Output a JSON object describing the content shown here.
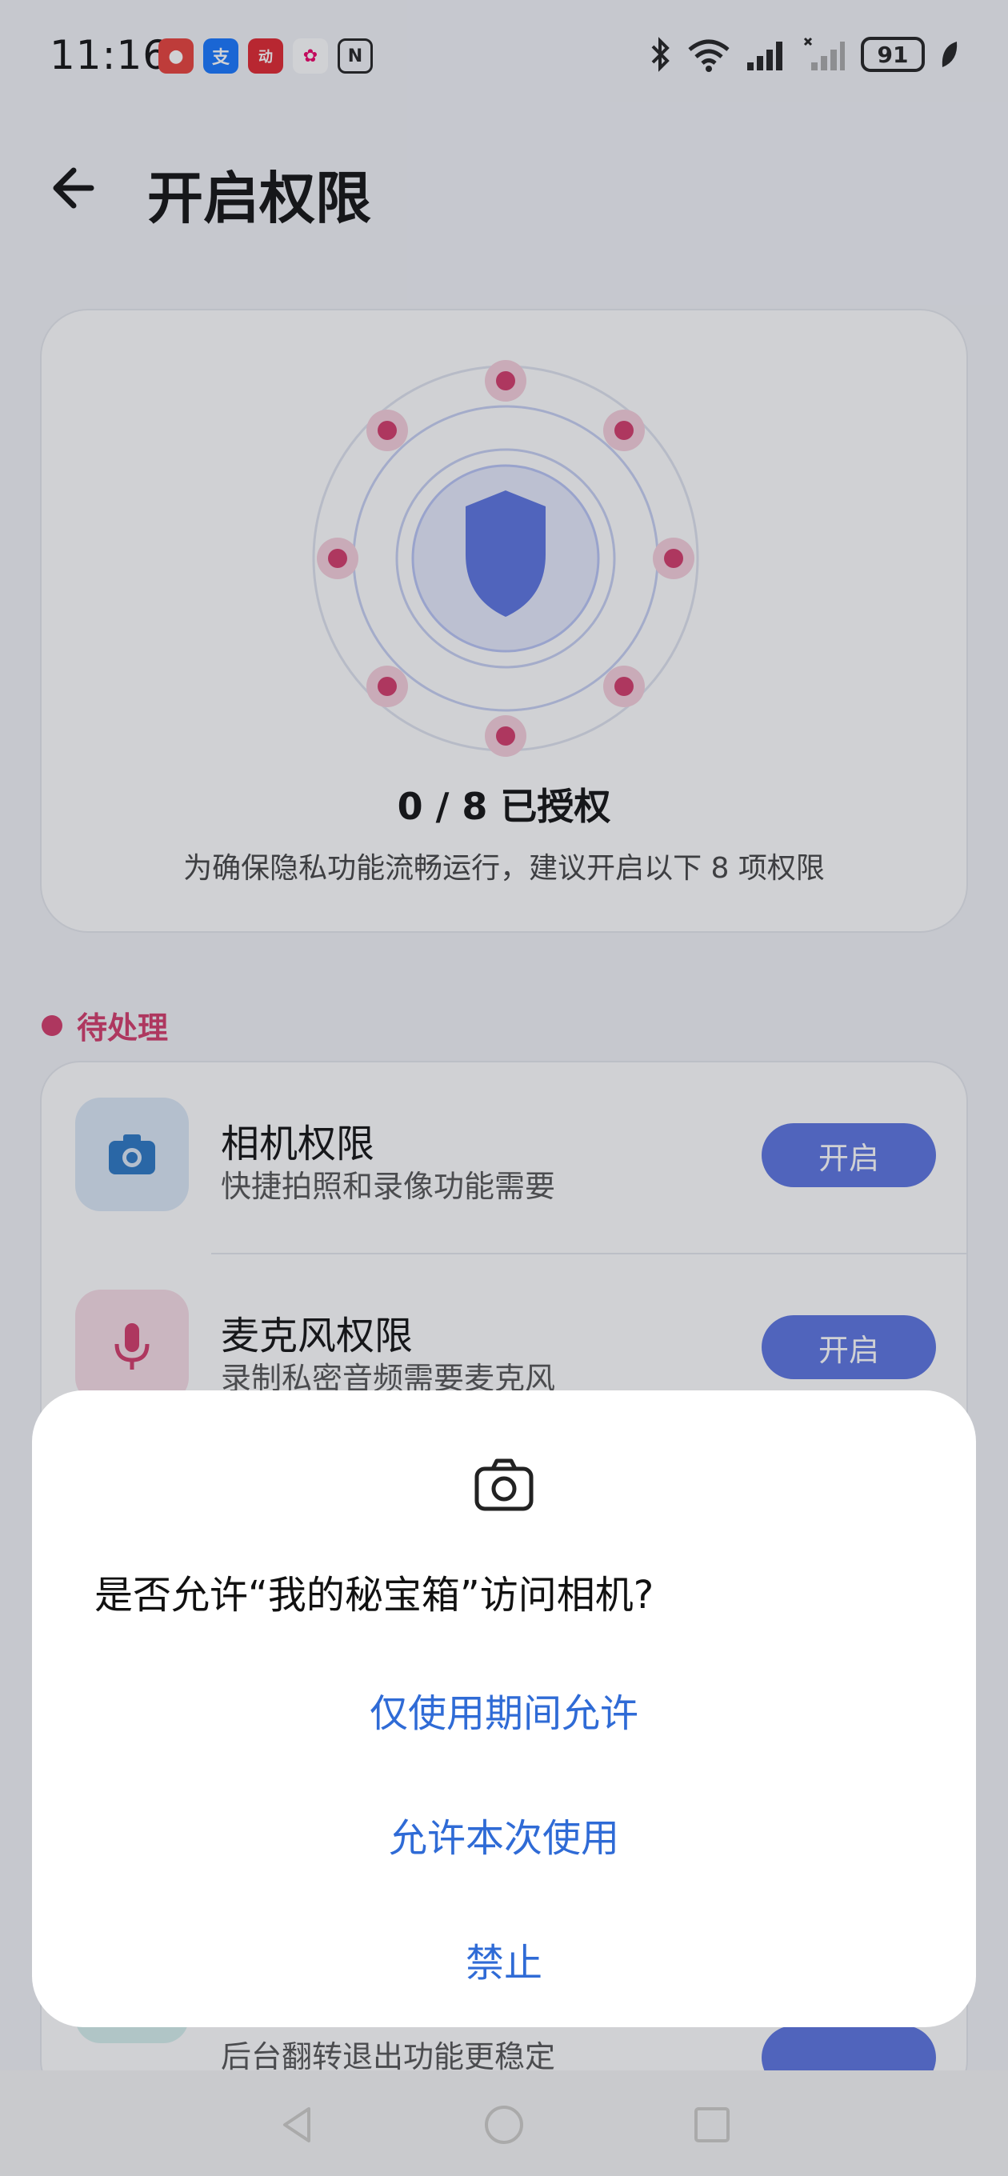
{
  "status_bar": {
    "time": "11:16",
    "battery": "91",
    "apps": [
      {
        "name": "app-red-mascot",
        "color": "#e8403a",
        "glyph": "●"
      },
      {
        "name": "alipay",
        "color": "#1677ff",
        "glyph": "支"
      },
      {
        "name": "app-red-promo",
        "color": "#e0262f",
        "glyph": "动"
      },
      {
        "name": "app-colorful",
        "color": "#ffffff",
        "glyph": "✿"
      },
      {
        "name": "nfc",
        "color": "#c8c9cc",
        "glyph": "N"
      }
    ]
  },
  "header": {
    "title": "开启权限"
  },
  "card": {
    "authorized_count": "0 / 8  已授权",
    "description": "为确保隐私功能流畅运行，建议开启以下 8 项权限"
  },
  "section": {
    "label": "待处理"
  },
  "permissions": [
    {
      "name": "相机权限",
      "desc": "快捷拍照和录像功能需要",
      "button": "开启",
      "icon": "camera-icon",
      "icon_bg": "#dce8f6",
      "icon_color": "#2b78c4"
    },
    {
      "name": "麦克风权限",
      "desc": "录制私密音频需要麦克风",
      "button": "开启",
      "icon": "microphone-icon",
      "icon_bg": "#f8dde6",
      "icon_color": "#d43a6a"
    },
    {
      "name": "",
      "desc": "后台翻转退出功能更稳定",
      "button": "",
      "icon": "sensor-icon",
      "icon_bg": "#d7f0ee",
      "icon_color": "#19a89a"
    }
  ],
  "dialog": {
    "title": "是否允许“我的秘宝箱”访问相机?",
    "actions": [
      "仅使用期间允许",
      "允许本次使用",
      "禁止"
    ]
  },
  "colors": {
    "accent": "#5b74e0",
    "pending": "#d43a6a",
    "dialog_action": "#2f6bd6"
  }
}
